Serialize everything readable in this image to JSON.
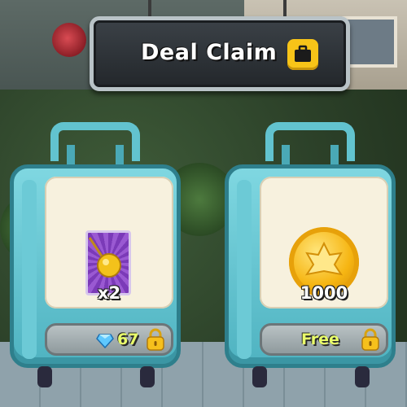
{
  "header": {
    "title": "Deal Claim",
    "icon": "briefcase-icon"
  },
  "offers": [
    {
      "item": "golden-pendant-card",
      "quantity": "x2",
      "price": "67",
      "currency_icon": "diamond-icon",
      "lock_icon": "padlock-icon"
    },
    {
      "item": "gold-coin",
      "quantity": "1000",
      "price": "Free",
      "lock_icon": "padlock-icon"
    }
  ],
  "colors": {
    "suitcase": "#62c3cf",
    "price_text": "#e9ff6a",
    "banner": "#2b3035",
    "coin": "#f6b512"
  }
}
